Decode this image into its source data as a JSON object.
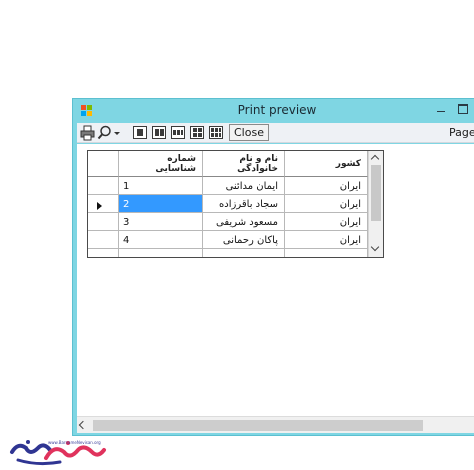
{
  "window": {
    "title": "Print preview"
  },
  "toolbar": {
    "icons": [
      "print-icon",
      "zoom-icon",
      "zoom-dropdown-icon",
      "one-page-icon",
      "two-pages-icon",
      "three-pages-icon",
      "four-pages-icon",
      "six-pages-icon"
    ],
    "close_label": "Close",
    "page_label": "Page"
  },
  "grid": {
    "headers": {
      "id_line1": "شماره",
      "id_line2": "شناسایی",
      "name_line1": "نام و نام",
      "name_line2": "خانوادگی",
      "country": "کشور"
    },
    "rows": [
      {
        "id": "1",
        "name": "ایمان مدائنی",
        "country": "ایران",
        "selected": false
      },
      {
        "id": "2",
        "name": "سجاد باقرزاده",
        "country": "ایران",
        "selected": true
      },
      {
        "id": "3",
        "name": "مسعود شریفی",
        "country": "ایران",
        "selected": false
      },
      {
        "id": "4",
        "name": "پاکان رحمانی",
        "country": "ایران",
        "selected": false
      }
    ],
    "selection_color": "#3399ff"
  },
  "watermark": {
    "url": "www.BarnameNevisan.org"
  },
  "colors": {
    "window_frame": "#7fd6e3",
    "toolbar_bg": "#eef1f5"
  }
}
